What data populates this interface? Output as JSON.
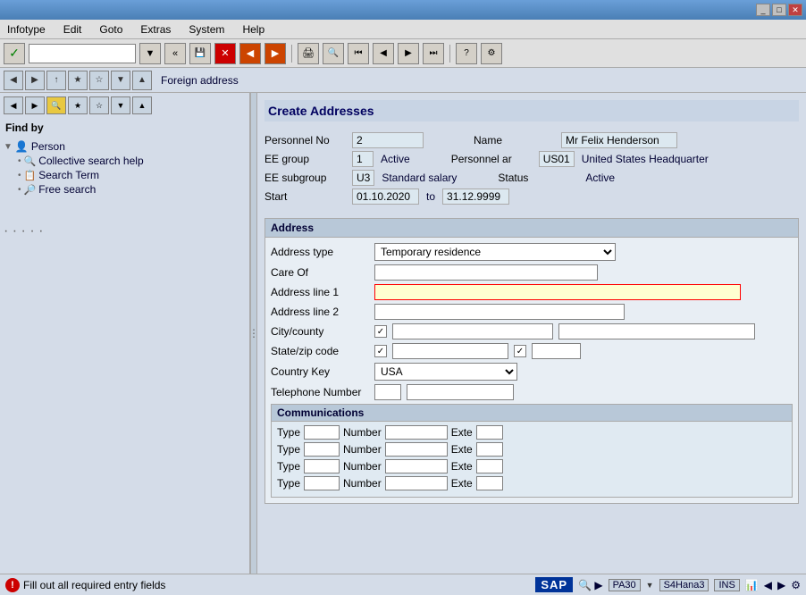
{
  "titleBar": {
    "buttons": [
      "_",
      "□",
      "✕"
    ]
  },
  "menuBar": {
    "items": [
      "Infotype",
      "Edit",
      "Goto",
      "Extras",
      "System",
      "Help"
    ]
  },
  "toolbar": {
    "inputValue": "",
    "inputPlaceholder": ""
  },
  "toolbar2": {
    "label": "Foreign address"
  },
  "pageTitle": "Create Addresses",
  "personInfo": {
    "personnelNoLabel": "Personnel No",
    "personnelNoValue": "2",
    "nameLabel": "Name",
    "nameValue": "Mr Felix Henderson",
    "eeGroupLabel": "EE group",
    "eeGroupValue": "1",
    "activeLabel": "Active",
    "personnelArLabel": "Personnel ar",
    "personnelArValue": "US01",
    "personnelArText": "United States Headquarter",
    "eeSubgroupLabel": "EE subgroup",
    "eeSubgroupValue": "U3",
    "standardSalaryLabel": "Standard salary",
    "statusLabel": "Status",
    "statusValue": "Active",
    "startLabel": "Start",
    "startValue": "01.10.2020",
    "toLabel": "to",
    "endValue": "31.12.9999"
  },
  "findBy": {
    "label": "Find by",
    "tree": {
      "personLabel": "Person",
      "collectiveSearchLabel": "Collective search help",
      "searchTermLabel": "Search Term",
      "freeSearchLabel": "Free search"
    }
  },
  "address": {
    "sectionLabel": "Address",
    "addressTypeLabel": "Address type",
    "addressTypeValue": "Temporary residence",
    "careOfLabel": "Care Of",
    "addressLine1Label": "Address line 1",
    "addressLine2Label": "Address line 2",
    "cityCountyLabel": "City/county",
    "stateZipLabel": "State/zip code",
    "countryKeyLabel": "Country Key",
    "countryKeyValue": "USA",
    "telephoneLabel": "Telephone Number",
    "communications": {
      "sectionLabel": "Communications",
      "rows": [
        {
          "typeLabel": "Type",
          "numberLabel": "Number",
          "exteLabel": "Exte"
        },
        {
          "typeLabel": "Type",
          "numberLabel": "Number",
          "exteLabel": "Exte"
        },
        {
          "typeLabel": "Type",
          "numberLabel": "Number",
          "exteLabel": "Exte"
        },
        {
          "typeLabel": "Type",
          "numberLabel": "Number",
          "exteLabel": "Exte"
        }
      ]
    }
  },
  "statusBar": {
    "errorMessage": "Fill out all required entry fields",
    "sapLogoText": "SAP",
    "pa30Label": "PA30",
    "s4hana3Label": "S4Hana3",
    "insLabel": "INS"
  }
}
